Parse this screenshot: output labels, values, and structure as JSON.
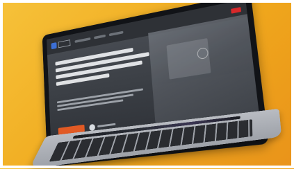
{
  "scene": {
    "background_color": "#f0a81c",
    "frame_color": "#ffffff",
    "device": "laptop",
    "screen_accent": "#e25a24",
    "brand_blue": "#3c6fd6"
  }
}
